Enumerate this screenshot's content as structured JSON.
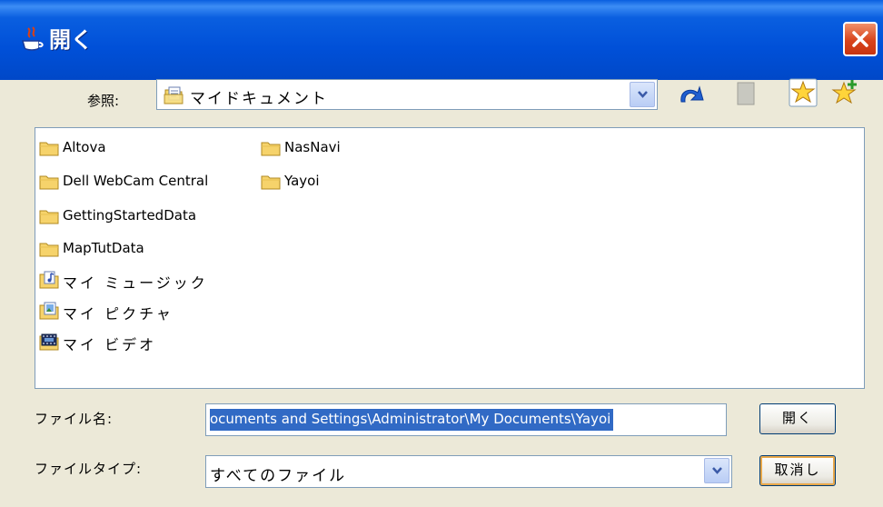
{
  "window": {
    "title": "開く"
  },
  "toolbar": {
    "look_in_label": "参照:",
    "look_in_value": "マイドキュメント",
    "icons": [
      "up-folder-icon",
      "new-folder-icon",
      "favorites-icon",
      "add-favorite-icon"
    ]
  },
  "file_list": {
    "items": [
      {
        "label": "Altova",
        "icon": "folder-icon"
      },
      {
        "label": "NasNavi",
        "icon": "folder-icon"
      },
      {
        "label": "Dell WebCam Central",
        "icon": "folder-icon"
      },
      {
        "label": "Yayoi",
        "icon": "folder-icon"
      },
      {
        "label": "GettingStartedData",
        "icon": "folder-icon"
      },
      {
        "label": "MapTutData",
        "icon": "folder-icon"
      },
      {
        "label": "マイ ミュージック",
        "icon": "my-music-icon"
      },
      {
        "label": "マイ ピクチャ",
        "icon": "my-pictures-icon"
      },
      {
        "label": "マイ ビデオ",
        "icon": "my-videos-icon"
      }
    ]
  },
  "file_name": {
    "label": "ファイル名:",
    "value": "ocuments and Settings\\Administrator\\My Documents\\Yayoi"
  },
  "file_type": {
    "label": "ファイルタイプ:",
    "value": "すべてのファイル"
  },
  "buttons": {
    "open_label": "開く",
    "cancel_label": "取消し"
  },
  "colors": {
    "titlebar": "#0a5fe0",
    "selection": "#316ac5",
    "dialog_bg": "#ece9d8",
    "close": "#d8441c"
  }
}
